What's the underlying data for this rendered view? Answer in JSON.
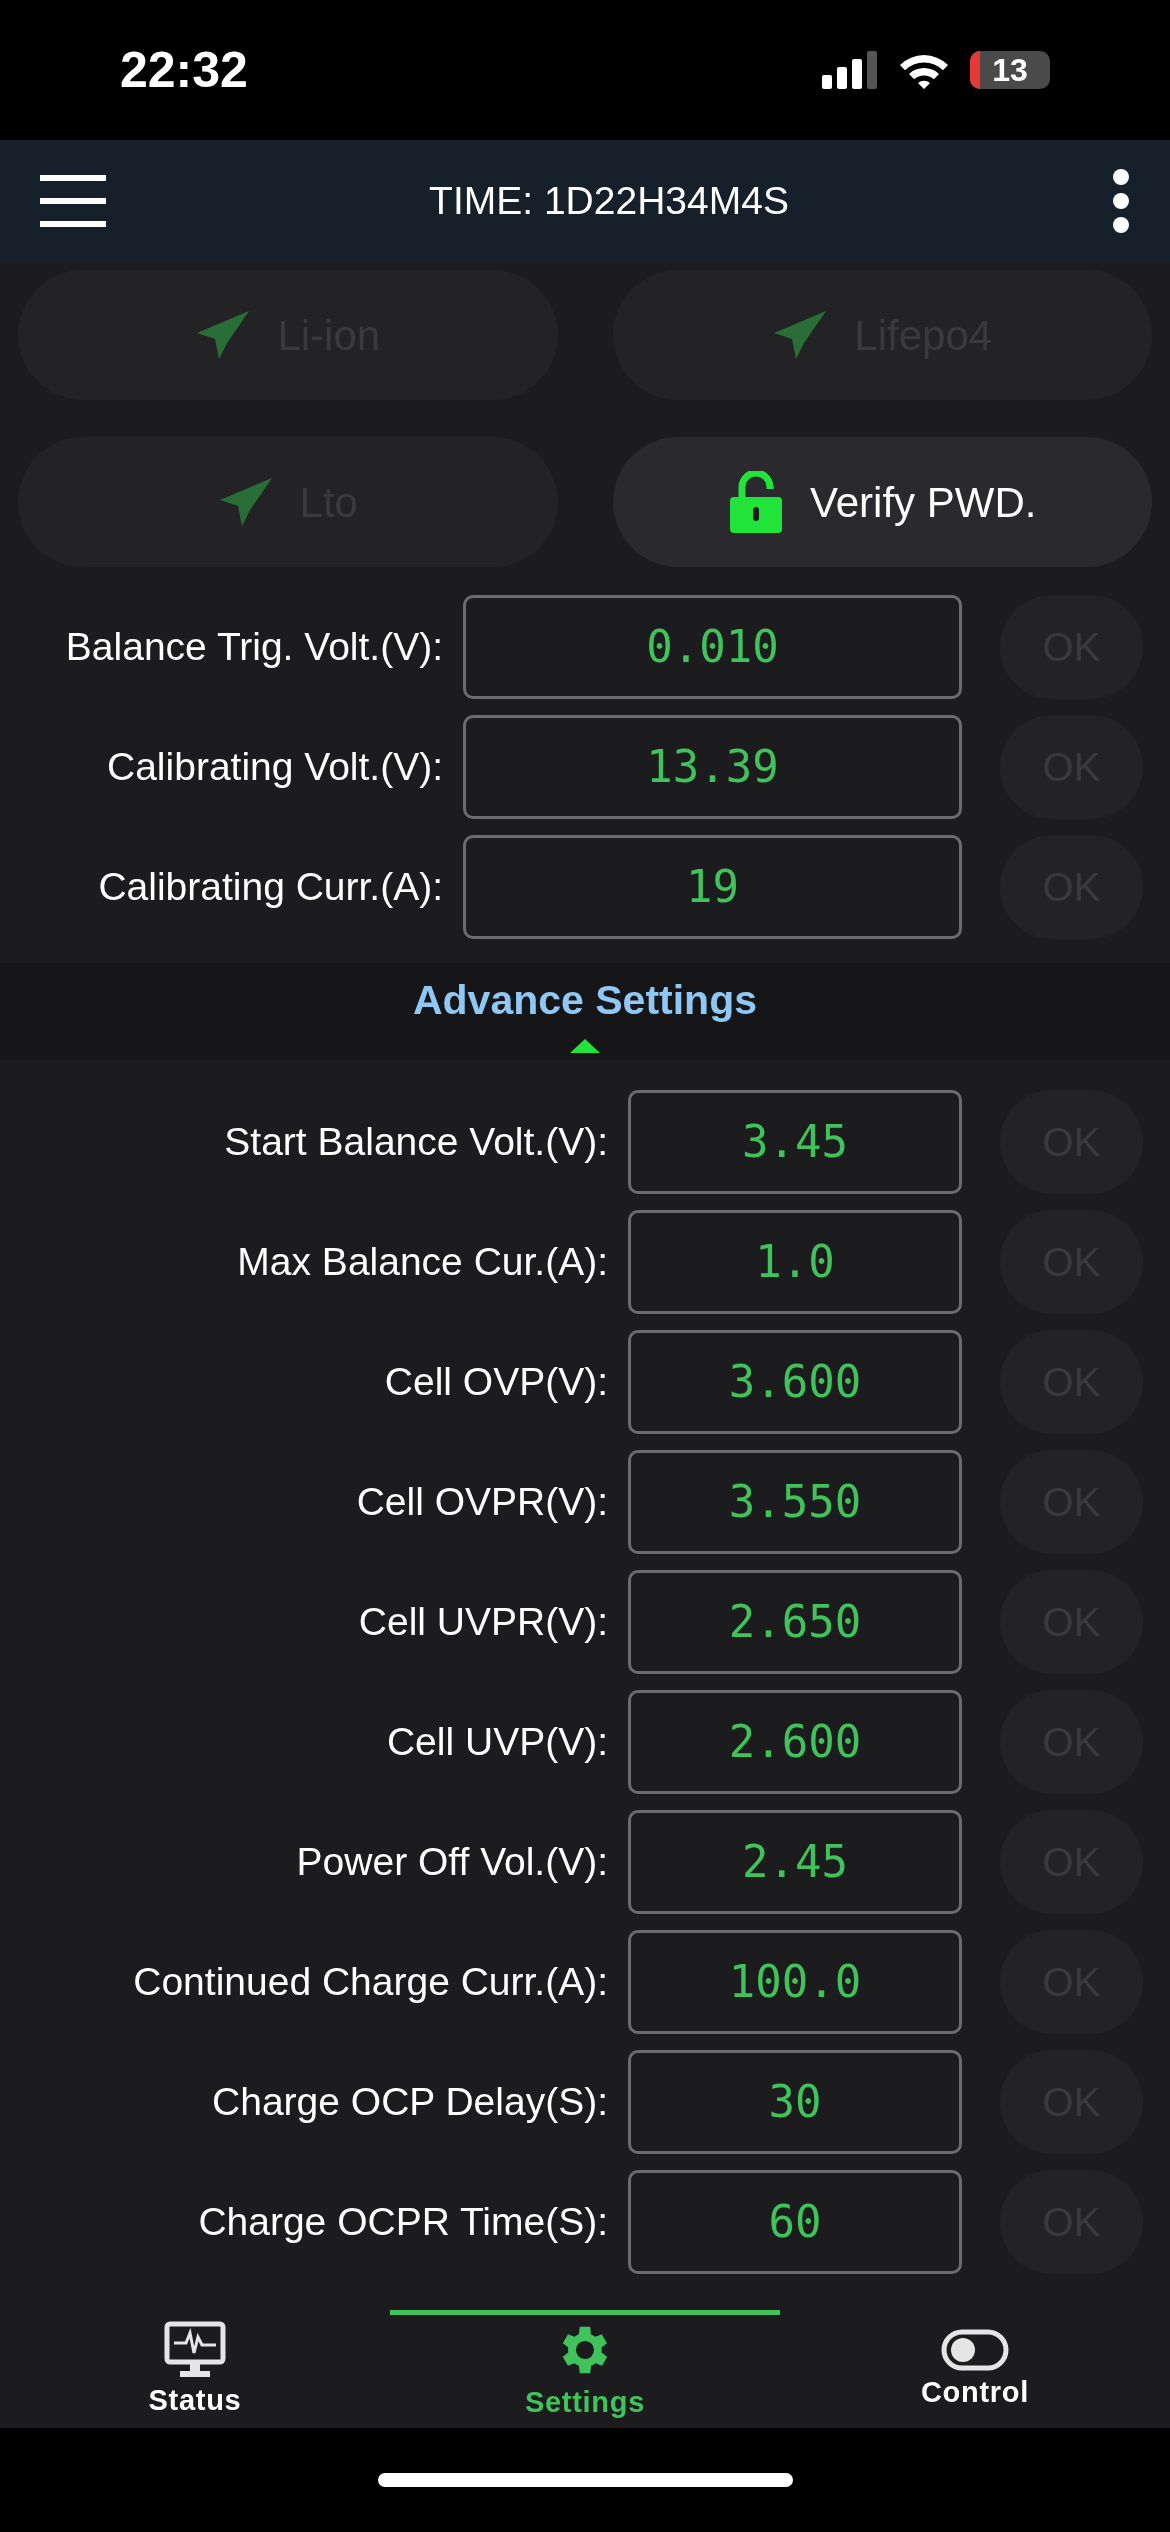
{
  "status_bar": {
    "time": "22:32",
    "battery": "13"
  },
  "header": {
    "title": "TIME: 1D22H34M4S"
  },
  "presets": [
    {
      "label": "Li-ion",
      "kind": "preset",
      "disabled": true
    },
    {
      "label": "Lifepo4",
      "kind": "preset",
      "disabled": true
    },
    {
      "label": "Lto",
      "kind": "preset",
      "disabled": true
    },
    {
      "label": "Verify PWD.",
      "kind": "lock",
      "disabled": false
    }
  ],
  "basic_settings": [
    {
      "label": "Balance Trig. Volt.(V):",
      "value": "0.010",
      "ok": "OK",
      "ok_disabled": true
    },
    {
      "label": "Calibrating Volt.(V):",
      "value": "13.39",
      "ok": "OK",
      "ok_disabled": true
    },
    {
      "label": "Calibrating Curr.(A):",
      "value": "19",
      "ok": "OK",
      "ok_disabled": true
    }
  ],
  "advance": {
    "title": "Advance Settings",
    "expanded": true
  },
  "advance_settings": [
    {
      "label": "Start Balance Volt.(V):",
      "value": "3.45",
      "ok": "OK",
      "ok_disabled": true
    },
    {
      "label": "Max Balance Cur.(A):",
      "value": "1.0",
      "ok": "OK",
      "ok_disabled": true
    },
    {
      "label": "Cell OVP(V):",
      "value": "3.600",
      "ok": "OK",
      "ok_disabled": true
    },
    {
      "label": "Cell OVPR(V):",
      "value": "3.550",
      "ok": "OK",
      "ok_disabled": true
    },
    {
      "label": "Cell UVPR(V):",
      "value": "2.650",
      "ok": "OK",
      "ok_disabled": true
    },
    {
      "label": "Cell UVP(V):",
      "value": "2.600",
      "ok": "OK",
      "ok_disabled": true
    },
    {
      "label": "Power Off Vol.(V):",
      "value": "2.45",
      "ok": "OK",
      "ok_disabled": true
    },
    {
      "label": "Continued Charge Curr.(A):",
      "value": "100.0",
      "ok": "OK",
      "ok_disabled": true
    },
    {
      "label": "Charge OCP Delay(S):",
      "value": "30",
      "ok": "OK",
      "ok_disabled": true
    },
    {
      "label": "Charge OCPR Time(S):",
      "value": "60",
      "ok": "OK",
      "ok_disabled": true
    }
  ],
  "nav": [
    {
      "label": "Status",
      "kind": "status",
      "selected": false
    },
    {
      "label": "Settings",
      "kind": "settings",
      "selected": true
    },
    {
      "label": "Control",
      "kind": "control",
      "selected": false
    }
  ]
}
